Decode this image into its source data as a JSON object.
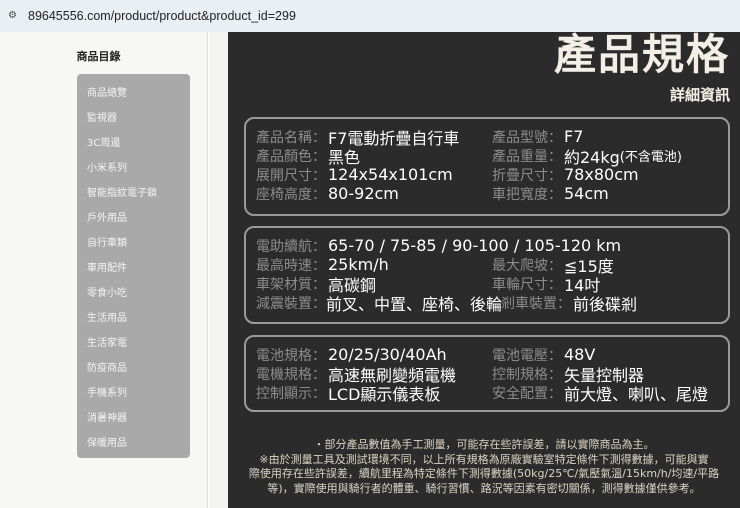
{
  "browser": {
    "url": "89645556.com/product/product&product_id=299"
  },
  "sidebar": {
    "title": "商品目錄",
    "items": [
      "商品總覽",
      "監視器",
      "3C周邊",
      "小米系列",
      "智能指紋電子鎖",
      "戶外用品",
      "自行車類",
      "車用配件",
      "零食小吃",
      "生活用品",
      "生活家電",
      "防疫商品",
      "手機系列",
      "消暑神器",
      "保暖用品"
    ]
  },
  "header": {
    "title": "產品規格",
    "subtitle": "詳細資訊"
  },
  "specs": [
    [
      [
        {
          "label": "產品名稱：",
          "value": "F7電動折疊自行車"
        },
        {
          "label": "產品型號：",
          "value": "F7"
        }
      ],
      [
        {
          "label": "產品顏色：",
          "value": "黑色"
        },
        {
          "label": "產品重量：",
          "value": "約24kg",
          "note": "(不含電池)"
        }
      ],
      [
        {
          "label": "展開尺寸：",
          "value": "124x54x101cm"
        },
        {
          "label": "折疊尺寸：",
          "value": "78x80cm"
        }
      ],
      [
        {
          "label": "座椅高度：",
          "value": "80-92cm"
        },
        {
          "label": "車把寬度：",
          "value": "54cm"
        }
      ]
    ],
    [
      [
        {
          "label": "電助續航：",
          "value": "65-70 / 75-85 / 90-100 / 105-120 km"
        }
      ],
      [
        {
          "label": "最高時速：",
          "value": "25km/h"
        },
        {
          "label": "最大爬坡：",
          "value": "≦15度"
        }
      ],
      [
        {
          "label": "車架材質：",
          "value": "高碳鋼"
        },
        {
          "label": "車輪尺寸：",
          "value": "14吋"
        }
      ],
      [
        {
          "label": "減震裝置：",
          "value": "前叉、中置、座椅、後輪"
        },
        {
          "label": "剎車裝置：",
          "value": "前後碟剎"
        }
      ]
    ],
    [
      [
        {
          "label": "電池規格：",
          "value": "20/25/30/40Ah"
        },
        {
          "label": "電池電壓：",
          "value": "48V"
        }
      ],
      [
        {
          "label": "電機規格：",
          "value": "高速無刷變頻電機"
        },
        {
          "label": "控制規格：",
          "value": "矢量控制器"
        }
      ],
      [
        {
          "label": "控制顯示：",
          "value": "LCD顯示儀表板"
        },
        {
          "label": "安全配置：",
          "value": "前大燈、喇叭、尾燈"
        }
      ]
    ]
  ],
  "footer": [
    "・部分產品數值為手工測量，可能存在些許誤差，請以實際商品為主。",
    "※由於測量工具及測試環境不同，以上所有規格為原廠實驗室特定條件下測得數據，可能與實",
    "際使用存在些許誤差，續航里程為特定條件下測得數據(50kg/25℃/氣壓氣溫/15km/h/均速/平路",
    "等)，實際使用與騎行者的體重、騎行習慣、路況等因素有密切關係，測得數據僅供參考。"
  ]
}
